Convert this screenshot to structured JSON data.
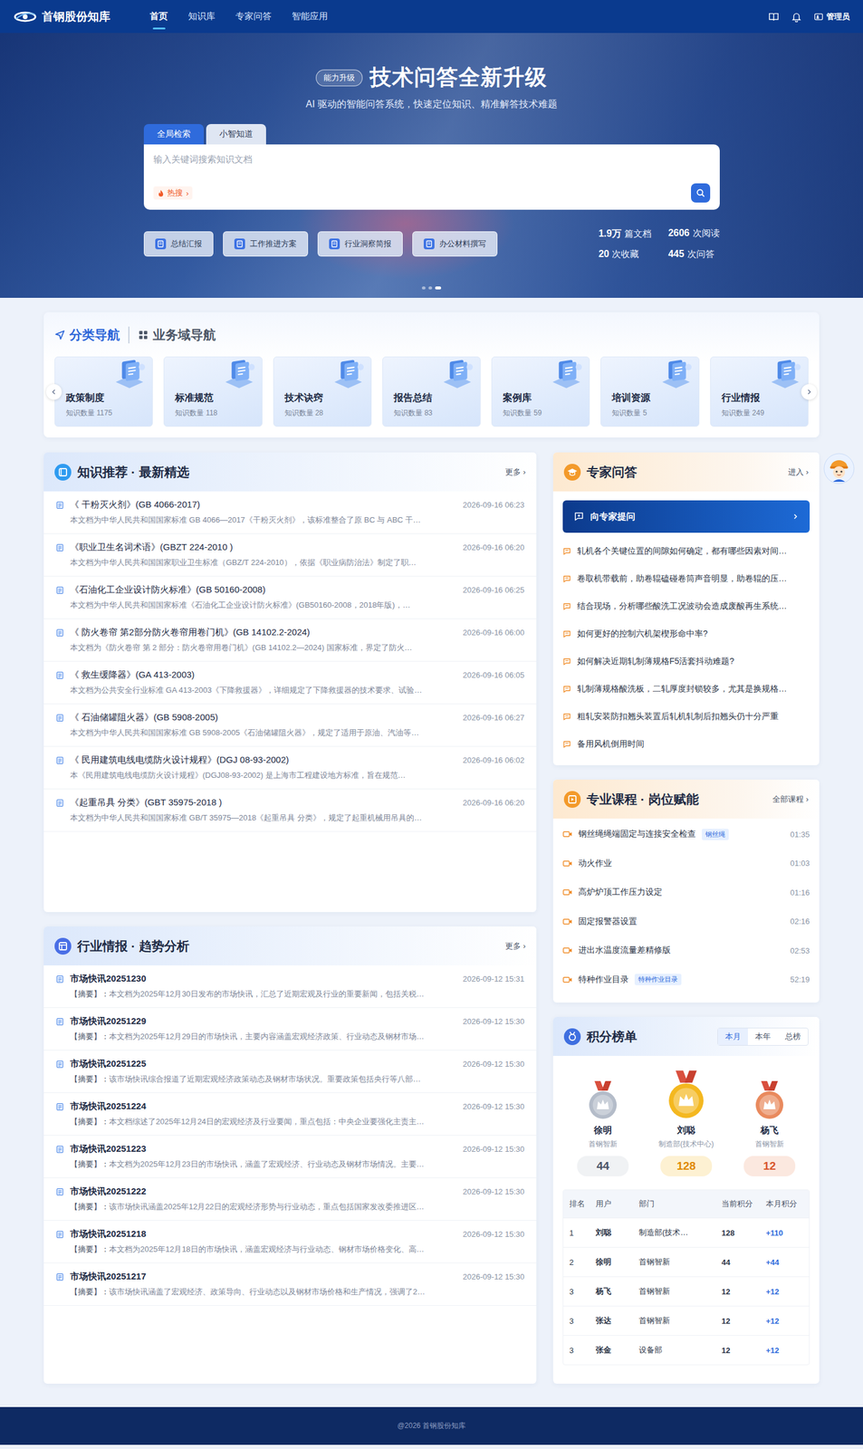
{
  "nav": {
    "logo": "首钢股份知库",
    "items": [
      {
        "label": "首页",
        "selected": true
      },
      {
        "label": "知识库",
        "selected": false
      },
      {
        "label": "专家问答",
        "selected": false
      },
      {
        "label": "智能应用",
        "selected": false
      }
    ],
    "user": "管理员"
  },
  "hero": {
    "badge": "能力升级",
    "title": "技术问答全新升级",
    "subtitle": "AI 驱动的智能问答系统，快速定位知识、精准解答技术难题",
    "search_tabs": [
      {
        "label": "全局检索",
        "selected": true
      },
      {
        "label": "小智知道",
        "selected": false
      }
    ],
    "search_placeholder": "输入关键词搜索知识文档",
    "hot": "热搜",
    "hot_arrow": "›",
    "quick_actions": [
      "总结汇报",
      "工作推进方案",
      "行业洞察简报",
      "办公材料撰写"
    ],
    "stats": [
      {
        "value": "1.9万",
        "unit": "篇文档"
      },
      {
        "value": "2606",
        "unit": "次阅读"
      },
      {
        "value": "20",
        "unit": "次收藏"
      },
      {
        "value": "445",
        "unit": "次问答"
      }
    ],
    "slides": [
      {
        "selected": false
      },
      {
        "selected": false
      },
      {
        "selected": true
      }
    ]
  },
  "category_nav": {
    "tabs": [
      {
        "label": "分类导航",
        "selected": true
      },
      {
        "label": "业务域导航",
        "selected": false
      }
    ],
    "items": [
      {
        "title": "政策制度",
        "count": "知识数量 1175"
      },
      {
        "title": "标准规范",
        "count": "知识数量 118"
      },
      {
        "title": "技术诀窍",
        "count": "知识数量 28"
      },
      {
        "title": "报告总结",
        "count": "知识数量 83"
      },
      {
        "title": "案例库",
        "count": "知识数量 59"
      },
      {
        "title": "培训资源",
        "count": "知识数量 5"
      },
      {
        "title": "行业情报",
        "count": "知识数量 249"
      }
    ]
  },
  "knowledge": {
    "title": "知识推荐 · 最新精选",
    "more": "更多 ›",
    "items": [
      {
        "title": "《 干粉灭火剂》(GB 4066-2017)",
        "date": "2026-09-16 06:23",
        "summary": "本文档为中华人民共和国国家标准 GB 4066—2017《干粉灭火剂》，该标准整合了原 BC 与 ABC 干…"
      },
      {
        "title": "《职业卫生名词术语》(GBZT 224-2010 )",
        "date": "2026-09-16 06:20",
        "summary": "本文档为中华人民共和国国家职业卫生标准（GBZ/T 224-2010），依据《职业病防治法》制定了职…"
      },
      {
        "title": "《石油化工企业设计防火标准》(GB 50160-2008)",
        "date": "2026-09-16 06:25",
        "summary": "本文档为中华人民共和国国家标准《石油化工企业设计防火标准》(GB50160-2008，2018年版)，…"
      },
      {
        "title": "《 防火卷帘 第2部分防火卷帘用卷门机》(GB 14102.2-2024)",
        "date": "2026-09-16 06:00",
        "summary": "本文档为《防火卷帘 第 2 部分：防火卷帘用卷门机》(GB 14102.2—2024) 国家标准，界定了防火…"
      },
      {
        "title": "《 救生缓降器》(GA 413-2003)",
        "date": "2026-09-16 06:05",
        "summary": "本文档为公共安全行业标准 GA 413-2003《下降救援器》，详细规定了下降救援器的技术要求、试验…"
      },
      {
        "title": "《 石油储罐阻火器》(GB 5908-2005)",
        "date": "2026-09-16 06:27",
        "summary": "本文档为中华人民共和国国家标准 GB 5908-2005《石油储罐阻火器》，规定了适用于原油、汽油等…"
      },
      {
        "title": "《 民用建筑电线电缆防火设计规程》(DGJ 08-93-2002)",
        "date": "2026-09-16 06:02",
        "summary": "本《民用建筑电线电缆防火设计规程》(DGJ08-93-2002) 是上海市工程建设地方标准，旨在规范…"
      },
      {
        "title": "《起重吊具 分类》(GBT 35975-2018 )",
        "date": "2026-09-16 06:20",
        "summary": "本文档为中华人民共和国国家标准 GB/T 35975—2018《起重吊具 分类》，规定了起重机械用吊具的…"
      }
    ]
  },
  "intel": {
    "title": "行业情报 · 趋势分析",
    "more": "更多 ›",
    "items": [
      {
        "title": "市场快讯20251230",
        "date": "2026-09-12 15:31",
        "label": "【摘要】：",
        "summary": "本文档为2025年12月30日发布的市场快讯，汇总了近期宏观及行业的重要新闻，包括关税…"
      },
      {
        "title": "市场快讯20251229",
        "date": "2026-09-12 15:30",
        "label": "【摘要】：",
        "summary": "本文档为2025年12月29日的市场快讯，主要内容涵盖宏观经济政策、行业动态及钢材市场…"
      },
      {
        "title": "市场快讯20251225",
        "date": "2026-09-12 15:30",
        "label": "【摘要】：",
        "summary": "该市场快讯综合报道了近期宏观经济政策动态及钢材市场状况。重要政策包括央行等八部…"
      },
      {
        "title": "市场快讯20251224",
        "date": "2026-09-12 15:30",
        "label": "【摘要】：",
        "summary": "本文档综述了2025年12月24日的宏观经济及行业要闻，重点包括：中央企业要强化主责主…"
      },
      {
        "title": "市场快讯20251223",
        "date": "2026-09-12 15:30",
        "label": "【摘要】：",
        "summary": "本文档为2025年12月23日的市场快讯，涵盖了宏观经济、行业动态及钢材市场情况。主要…"
      },
      {
        "title": "市场快讯20251222",
        "date": "2026-09-12 15:30",
        "label": "【摘要】：",
        "summary": "该市场快讯涵盖2025年12月22日的宏观经济形势与行业动态，重点包括国家发改委推进区…"
      },
      {
        "title": "市场快讯20251218",
        "date": "2026-09-12 15:30",
        "label": "【摘要】：",
        "summary": "本文档为2025年12月18日的市场快讯，涵盖宏观经济与行业动态、钢材市场价格变化、高…"
      },
      {
        "title": "市场快讯20251217",
        "date": "2026-09-12 15:30",
        "label": "【摘要】：",
        "summary": "该市场快讯涵盖了宏观经济、政策导向、行业动态以及钢材市场价格和生产情况，强调了2…"
      }
    ]
  },
  "expert": {
    "title": "专家问答",
    "enter": "进入 ›",
    "ask_button": "向专家提问",
    "questions": [
      "轧机各个关键位置的间隙如何确定，都有哪些因素对间…",
      "卷取机带载前，助卷辊磕碰卷筒声音明显，助卷辊的压…",
      "结合现场，分析哪些酸洗工况波动会造成废酸再生系统…",
      "如何更好的控制六机架楔形命中率?",
      "如何解决近期轧制薄规格F5活套抖动难题?",
      "轧制薄规格酸洗板，二轧厚度封锁较多，尤其是换规格…",
      "粗轧安装防扣翘头装置后轧机轧制后扣翘头仍十分严重",
      "备用风机倒用时间"
    ]
  },
  "courses": {
    "title": "专业课程 · 岗位赋能",
    "more": "全部课程 ›",
    "items": [
      {
        "title": "钢丝绳绳端固定与连接安全检查",
        "tag": "钢丝绳",
        "duration": "01:35"
      },
      {
        "title": "动火作业",
        "tag": "",
        "duration": "01:03"
      },
      {
        "title": "高炉炉顶工作压力设定",
        "tag": "",
        "duration": "01:16"
      },
      {
        "title": "固定报警器设置",
        "tag": "",
        "duration": "02:16"
      },
      {
        "title": "进出水温度流量差精修版",
        "tag": "",
        "duration": "02:53"
      },
      {
        "title": "特种作业目录",
        "tag": "特种作业目录",
        "duration": "52:19"
      }
    ]
  },
  "leaderboard": {
    "title": "积分榜单",
    "periods": [
      {
        "label": "本月",
        "selected": true
      },
      {
        "label": "本年",
        "selected": false
      },
      {
        "label": "总榜",
        "selected": false
      }
    ],
    "podium": [
      {
        "name": "徐明",
        "dept": "首钢智新",
        "score": "44",
        "highlight": false,
        "color": "#b4bcc9",
        "score_color": "#4a5468"
      },
      {
        "name": "刘聪",
        "dept": "制造部(技术中心)",
        "score": "128",
        "highlight": true,
        "color": "#f4b820",
        "score_color": "#e08a00"
      },
      {
        "name": "杨飞",
        "dept": "首钢智新",
        "score": "12",
        "highlight": false,
        "color": "#e98a5e",
        "score_color": "#d9562c"
      }
    ],
    "columns": [
      "排名",
      "用户",
      "部门",
      "当前积分",
      "本月积分"
    ],
    "rows": [
      {
        "rank": "1",
        "user": "刘聪",
        "dept": "制造部(技术…",
        "current": "128",
        "month": "+110"
      },
      {
        "rank": "2",
        "user": "徐明",
        "dept": "首钢智新",
        "current": "44",
        "month": "+44"
      },
      {
        "rank": "3",
        "user": "杨飞",
        "dept": "首钢智新",
        "current": "12",
        "month": "+12"
      },
      {
        "rank": "3",
        "user": "张达",
        "dept": "首钢智新",
        "current": "12",
        "month": "+12"
      },
      {
        "rank": "3",
        "user": "张金",
        "dept": "设备部",
        "current": "12",
        "month": "+12"
      }
    ]
  },
  "footer": "@2026 首钢股份知库"
}
